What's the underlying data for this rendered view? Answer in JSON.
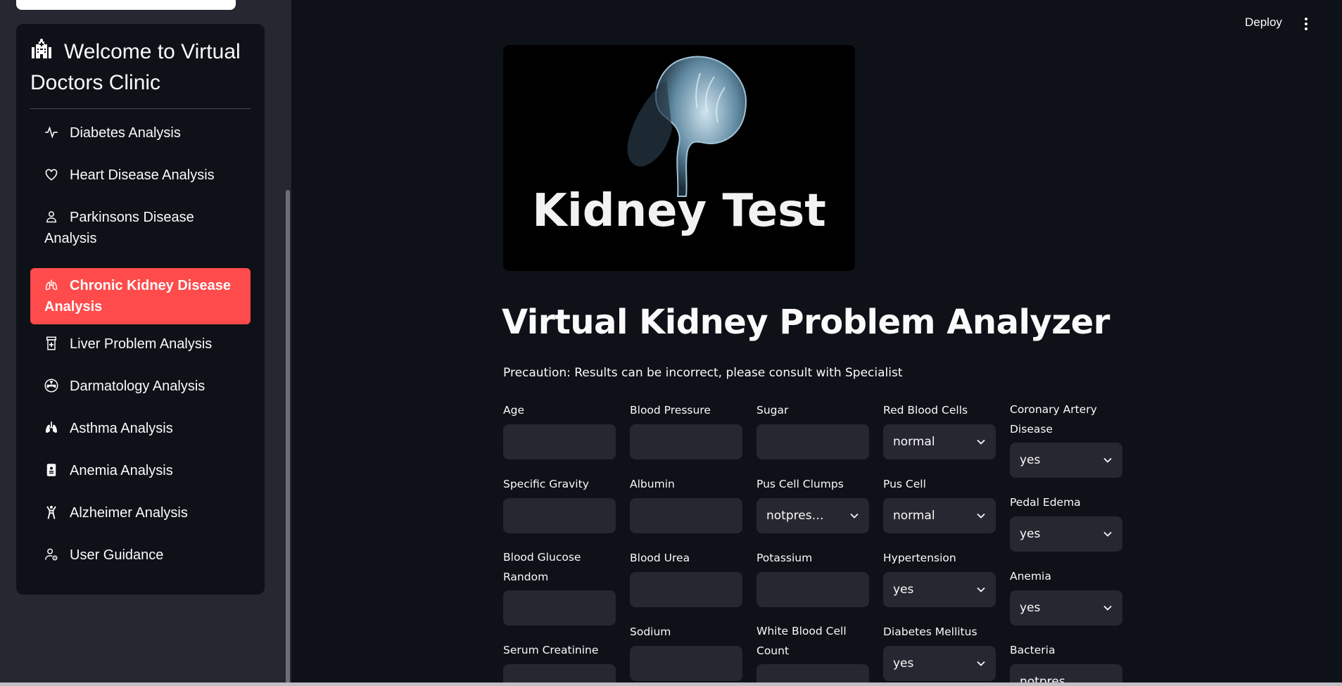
{
  "sidebar": {
    "title": "Welcome to Virtual Doctors Clinic",
    "title_icon": "hospital-icon",
    "items": [
      {
        "label": "Diabetes Analysis",
        "icon": "activity-icon",
        "active": false
      },
      {
        "label": "Heart Disease Analysis",
        "icon": "heart-icon",
        "active": false
      },
      {
        "label": "Parkinsons Disease Analysis",
        "icon": "person-icon",
        "active": false
      },
      {
        "label": "Chronic Kidney Disease Analysis",
        "icon": "lungs-icon",
        "active": true
      },
      {
        "label": "Liver Problem Analysis",
        "icon": "prescription-icon",
        "active": false
      },
      {
        "label": "Darmatology Analysis",
        "icon": "radioactive-icon",
        "active": false
      },
      {
        "label": "Asthma Analysis",
        "icon": "lungs-fill-icon",
        "active": false
      },
      {
        "label": "Anemia Analysis",
        "icon": "badge-icon",
        "active": false
      },
      {
        "label": "Alzheimer Analysis",
        "icon": "person-arms-up-icon",
        "active": false
      },
      {
        "label": "User Guidance",
        "icon": "person-gear-icon",
        "active": false
      }
    ]
  },
  "header": {
    "deploy_label": "Deploy",
    "menu_icon": "kebab-menu-icon"
  },
  "hero": {
    "image_text": "Kidney Test",
    "image_icon": "kidney-icon"
  },
  "main": {
    "title": "Virtual Kidney Problem Analyzer",
    "precaution": "Precaution: Results can be incorrect, please consult with Specialist"
  },
  "form": {
    "col1": [
      {
        "label": "Age",
        "type": "input",
        "value": ""
      },
      {
        "label": "Specific Gravity",
        "type": "input",
        "value": ""
      },
      {
        "label": "Blood Glucose Random",
        "type": "input",
        "value": ""
      },
      {
        "label": "Serum Creatinine",
        "type": "input",
        "value": ""
      }
    ],
    "col2": [
      {
        "label": "Blood Pressure",
        "type": "input",
        "value": ""
      },
      {
        "label": "Albumin",
        "type": "input",
        "value": ""
      },
      {
        "label": "Blood Urea",
        "type": "input",
        "value": ""
      },
      {
        "label": "Sodium",
        "type": "input",
        "value": ""
      }
    ],
    "col3": [
      {
        "label": "Sugar",
        "type": "input",
        "value": ""
      },
      {
        "label": "Pus Cell Clumps",
        "type": "select",
        "value": "notpresent"
      },
      {
        "label": "Potassium",
        "type": "input",
        "value": ""
      },
      {
        "label": "White Blood Cell Count",
        "type": "input",
        "value": ""
      }
    ],
    "col4": [
      {
        "label": "Red Blood Cells",
        "type": "select",
        "value": "normal"
      },
      {
        "label": "Pus Cell",
        "type": "select",
        "value": "normal"
      },
      {
        "label": "Hypertension",
        "type": "select",
        "value": "yes"
      },
      {
        "label": "Diabetes Mellitus",
        "type": "select",
        "value": "yes"
      }
    ],
    "col5": [
      {
        "label": "Coronary Artery Disease",
        "type": "select",
        "value": "yes"
      },
      {
        "label": "Pedal Edema",
        "type": "select",
        "value": "yes"
      },
      {
        "label": "Anemia",
        "type": "select",
        "value": "yes"
      },
      {
        "label": "Bacteria",
        "type": "select",
        "value": "notpresent"
      }
    ]
  },
  "colors": {
    "background": "#0e1117",
    "sidebar": "#262730",
    "accent": "#ff4b4b",
    "input_bg": "#262730"
  }
}
